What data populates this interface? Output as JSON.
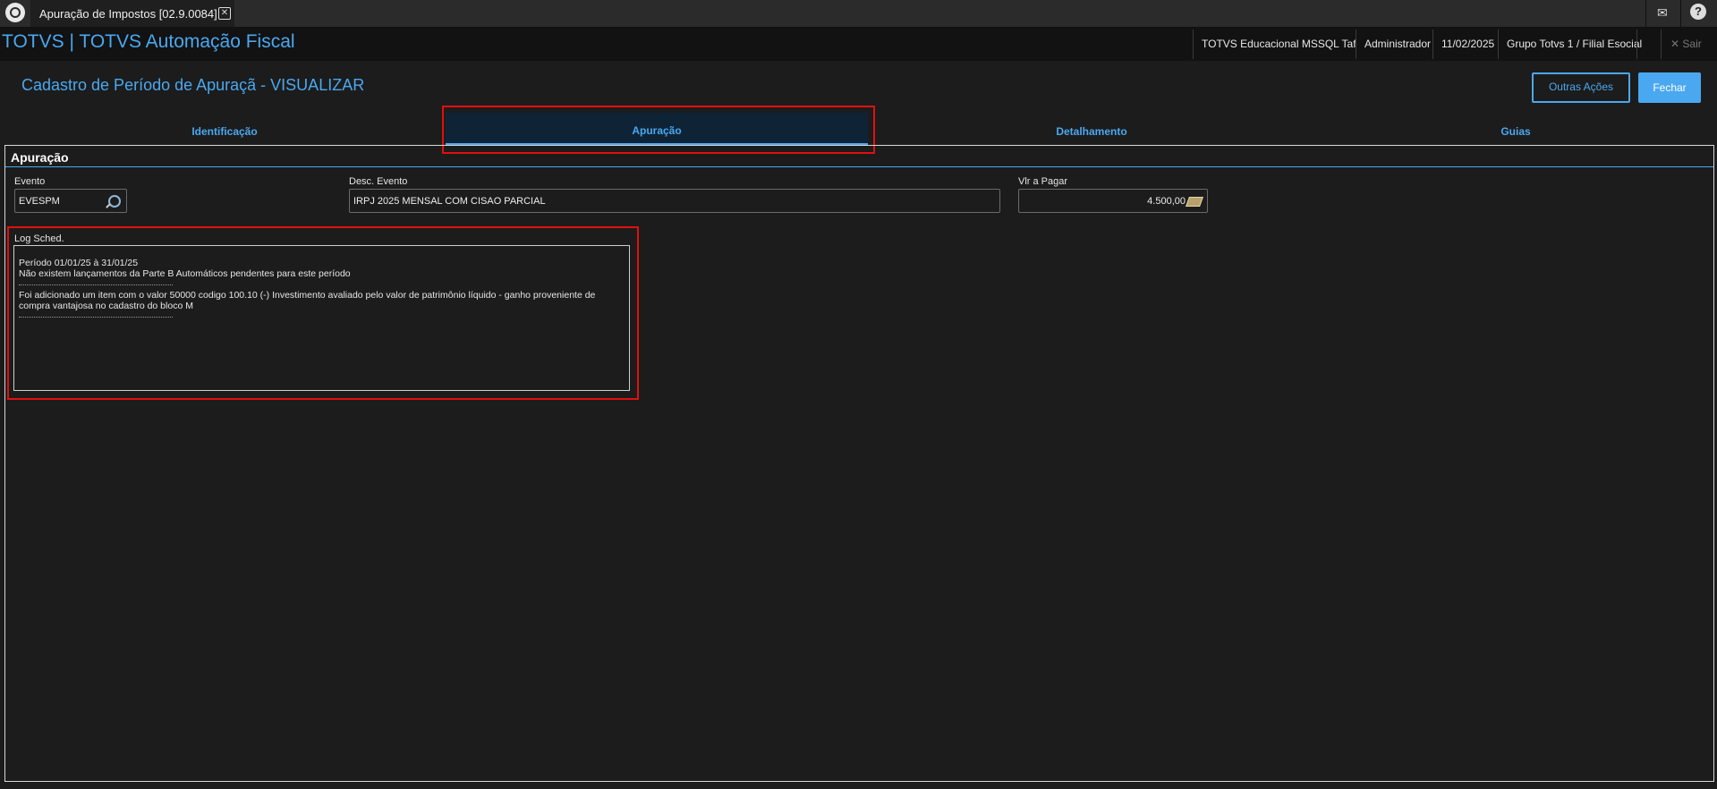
{
  "window_tab": {
    "title": "Apuração de Impostos [02.9.0084]"
  },
  "header": {
    "app_title": "TOTVS | TOTVS Automação Fiscal",
    "environment": "TOTVS Educacional MSSQL Taf",
    "user": "Administrador",
    "date": "11/02/2025",
    "branch": "Grupo Totvs 1 / Filial Esocial",
    "exit_label": "Sair"
  },
  "form": {
    "title": "Cadastro de Período de Apuraçã - VISUALIZAR",
    "other_actions_label": "Outras Ações",
    "close_label": "Fechar"
  },
  "tabs": [
    {
      "label": "Identificação"
    },
    {
      "label": "Apuração",
      "active": true
    },
    {
      "label": "Detalhamento"
    },
    {
      "label": "Guias"
    }
  ],
  "panel": {
    "title": "Apuração",
    "evento": {
      "label": "Evento",
      "value": "EVESPM"
    },
    "desc_evento": {
      "label": "Desc. Evento",
      "value": "IRPJ 2025 MENSAL COM CISAO PARCIAL"
    },
    "vlr_pagar": {
      "label": "Vlr a Pagar",
      "value": "4.500,00"
    },
    "log": {
      "label": "Log Sched.",
      "lines": [
        "Período 01/01/25 à  31/01/25",
        "Não existem lançamentos da Parte B Automáticos pendentes para este período",
        "Foi adicionado um item com o valor 50000 codigo 100.10 (-) Investimento avaliado pelo valor de patrimônio líquido - ganho proveniente de",
        "compra vantajosa no cadastro do bloco M"
      ]
    }
  },
  "icons": {
    "logo": "totvs-logo-icon",
    "tab_close": "close-icon",
    "mail": "mail-icon",
    "help": "help-icon",
    "lookup": "search-icon",
    "money": "money-icon",
    "exit": "close-icon"
  },
  "colors": {
    "accent": "#4aa8f0",
    "highlight_box": "#e01010",
    "background": "#1c1c1c"
  }
}
